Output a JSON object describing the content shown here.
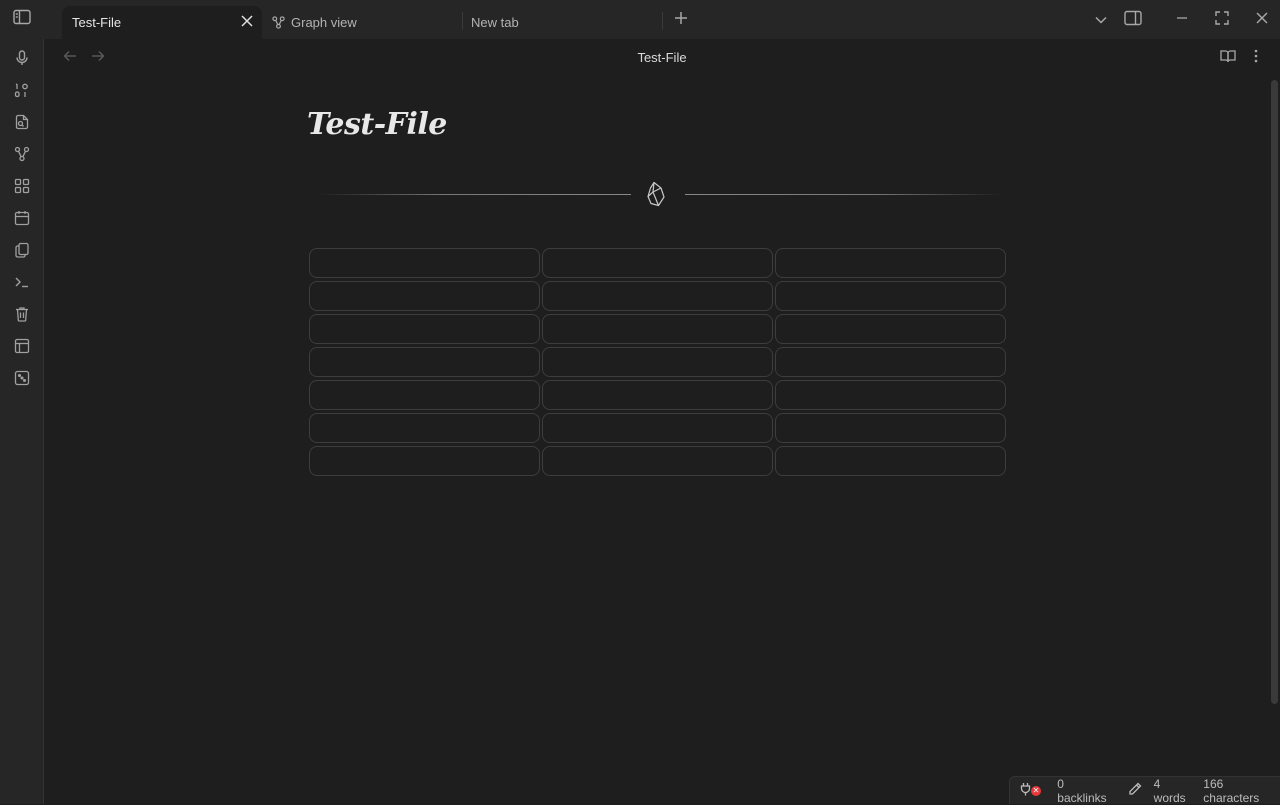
{
  "window": {
    "tabs": [
      {
        "label": "Test-File",
        "active": true
      },
      {
        "label": "Graph view",
        "active": false
      },
      {
        "label": "New tab",
        "active": false
      }
    ]
  },
  "ribbon": {
    "icons": [
      "microphone-icon",
      "switcher-icon",
      "search-file-icon",
      "graph-icon",
      "canvas-icon",
      "calendar-icon",
      "copy-icon",
      "terminal-icon",
      "trash-icon",
      "layout-icon",
      "dice-icon"
    ]
  },
  "view": {
    "title": "Test-File"
  },
  "note": {
    "title": "Test-File",
    "grid_rows": 7,
    "grid_cols": 3
  },
  "status": {
    "backlinks": "0 backlinks",
    "words": "4 words",
    "characters": "166 characters",
    "sync_badge": "✕"
  },
  "colors": {
    "background": "#1e1e1e",
    "chrome": "#262626",
    "accent_error": "#e5393b"
  }
}
